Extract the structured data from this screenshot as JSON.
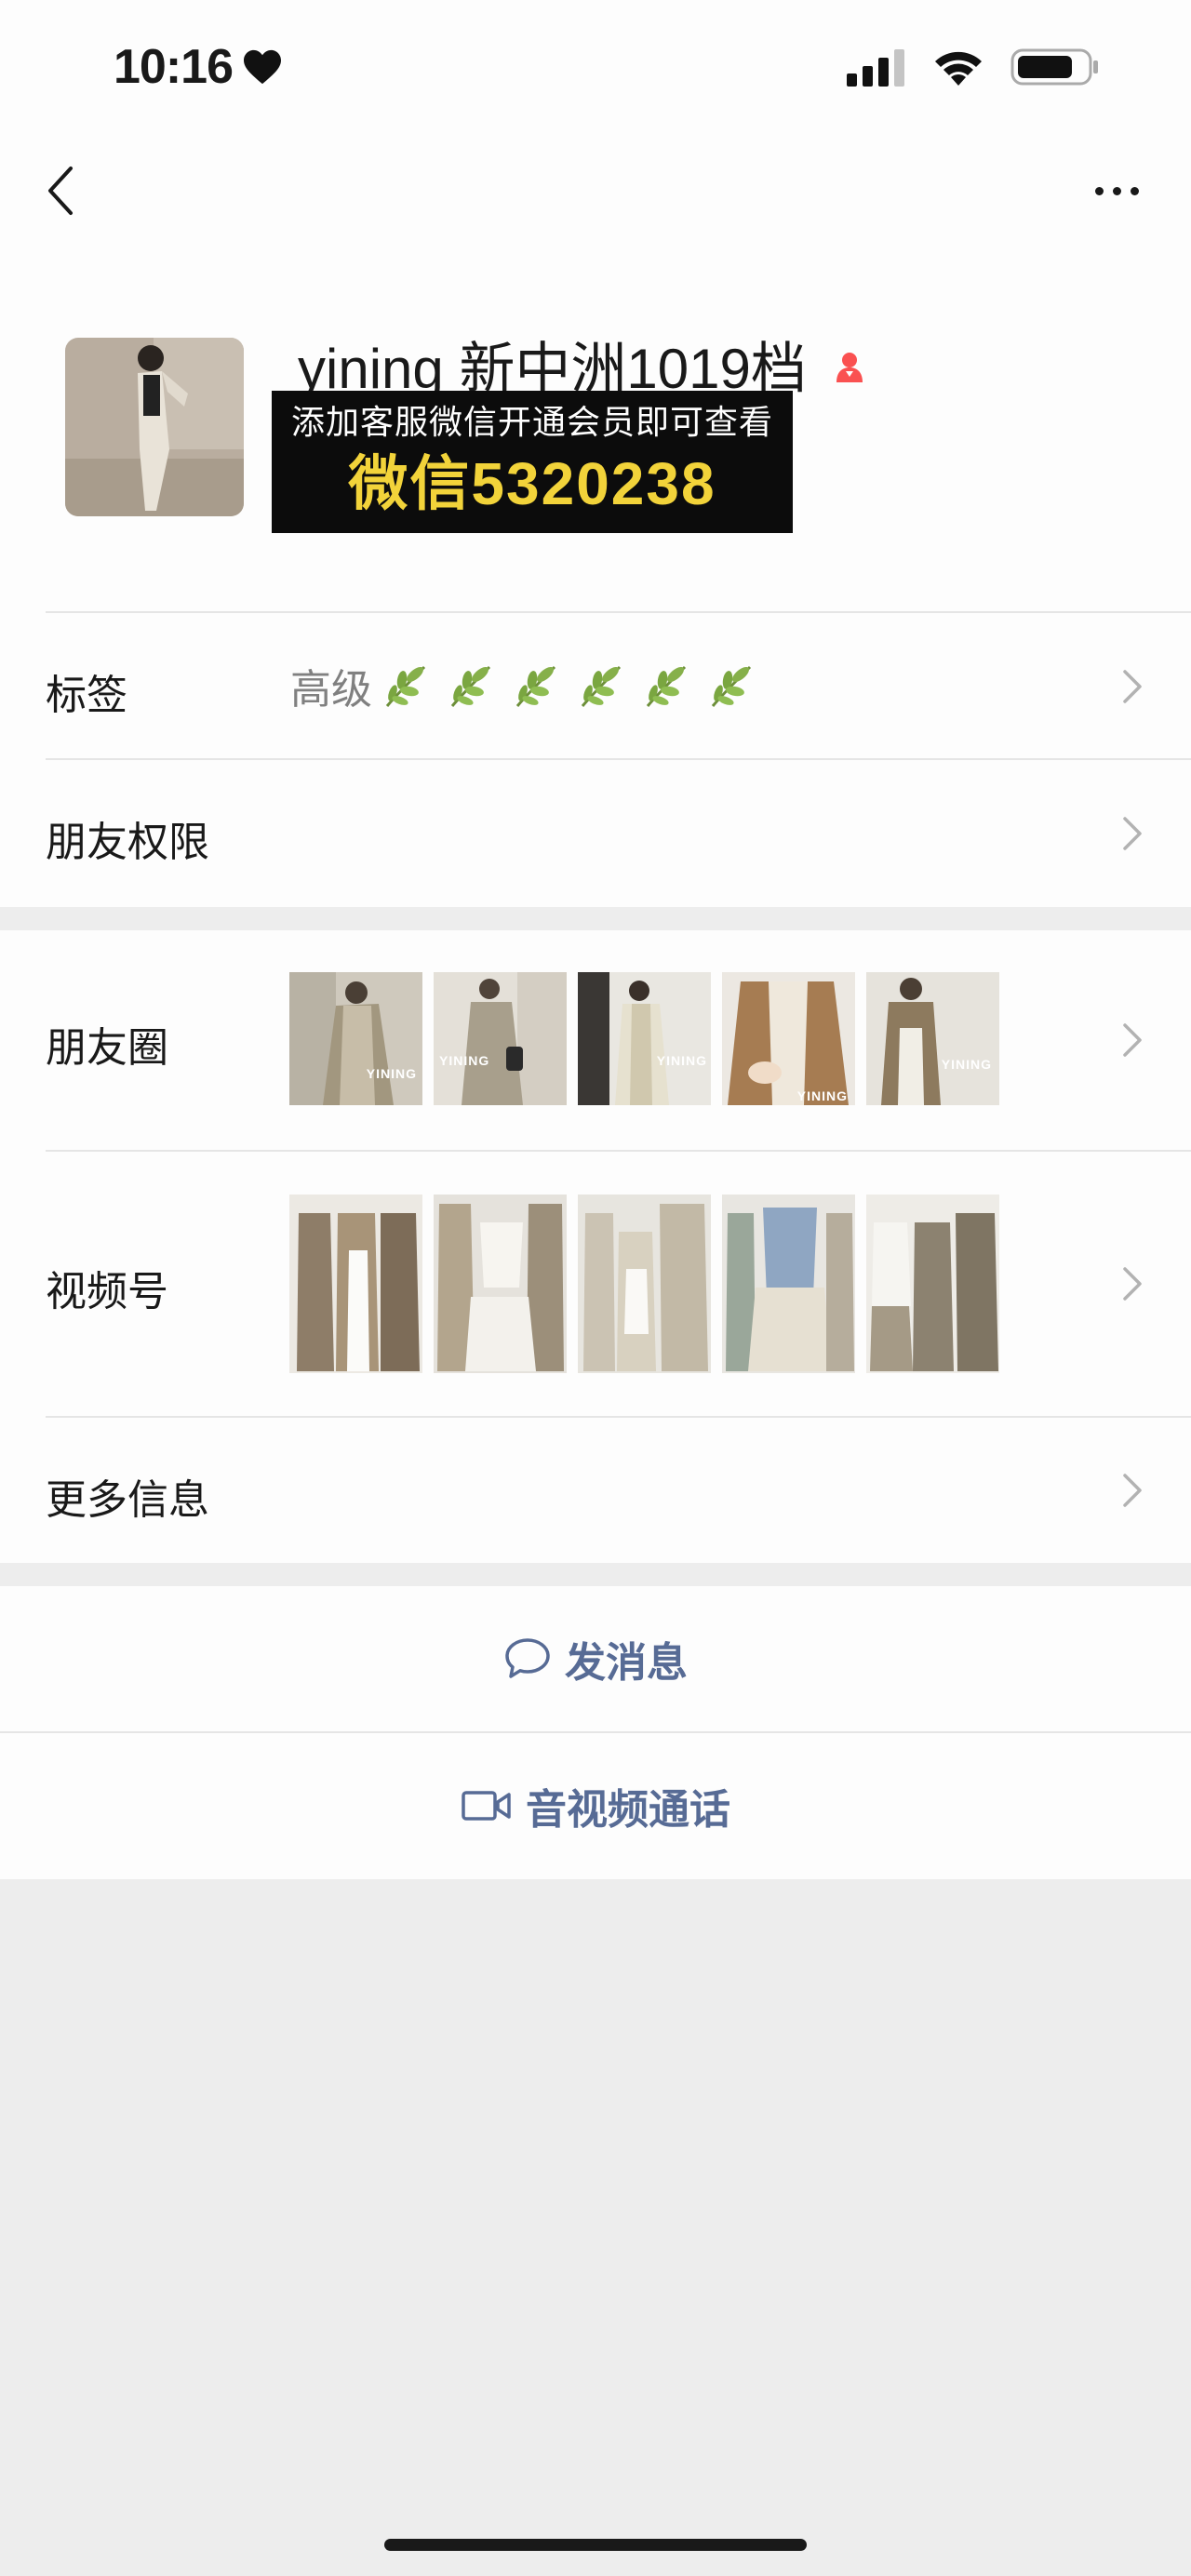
{
  "status_bar": {
    "time": "10:16"
  },
  "profile": {
    "name": "yining 新中洲1019档",
    "promo_line1": "添加客服微信开通会员即可查看",
    "promo_line2": "微信5320238"
  },
  "rows": {
    "tags": {
      "label": "标签",
      "value": "高级"
    },
    "permissions": {
      "label": "朋友权限"
    },
    "moments": {
      "label": "朋友圈",
      "watermark": "YINING"
    },
    "channels": {
      "label": "视频号"
    },
    "more_info": {
      "label": "更多信息"
    }
  },
  "actions": {
    "message": "发消息",
    "call": "音视频通话"
  },
  "colors": {
    "link_blue": "#576b95",
    "promo_yellow": "#f2d33a",
    "leaf_green": "#7cb342"
  }
}
